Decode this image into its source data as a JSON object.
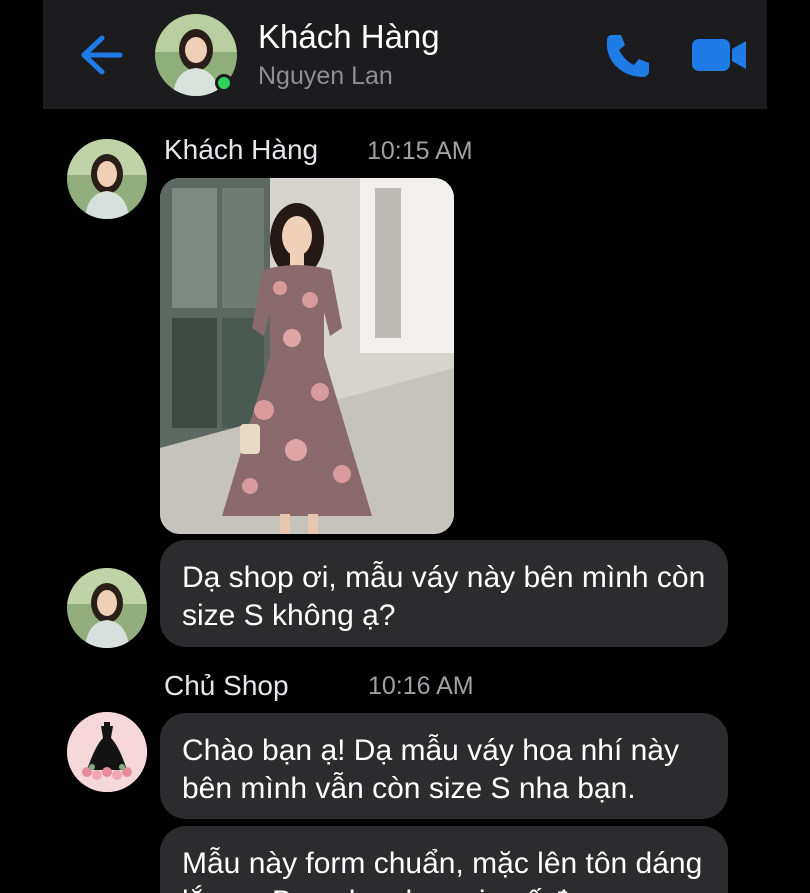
{
  "header": {
    "title": "Khách Hàng",
    "subtitle": "Nguyen Lan"
  },
  "icons": {
    "back": "back-arrow-icon",
    "call": "phone-icon",
    "video": "video-camera-icon"
  },
  "colors": {
    "accent": "#1f7ce6",
    "bubble": "#2c2c2e",
    "online": "#30d158",
    "header_bg": "#1c1c1e"
  },
  "messages": [
    {
      "sender": "Khách Hàng",
      "time": "10:15 AM",
      "photo": "woman-in-floral-dress-photo",
      "text": "Dạ shop ơi, mẫu váy này bên mình còn size S không ạ?"
    },
    {
      "sender": "Chủ Shop",
      "time": "10:16 AM",
      "text": "Chào bạn ạ! Dạ mẫu váy hoa nhí này bên mình vẫn còn size S nha bạn."
    },
    {
      "text": "Mẫu này form chuẩn, mặc lên tôn dáng lắm ạ. Bạn cho shop xin số đo"
    }
  ]
}
